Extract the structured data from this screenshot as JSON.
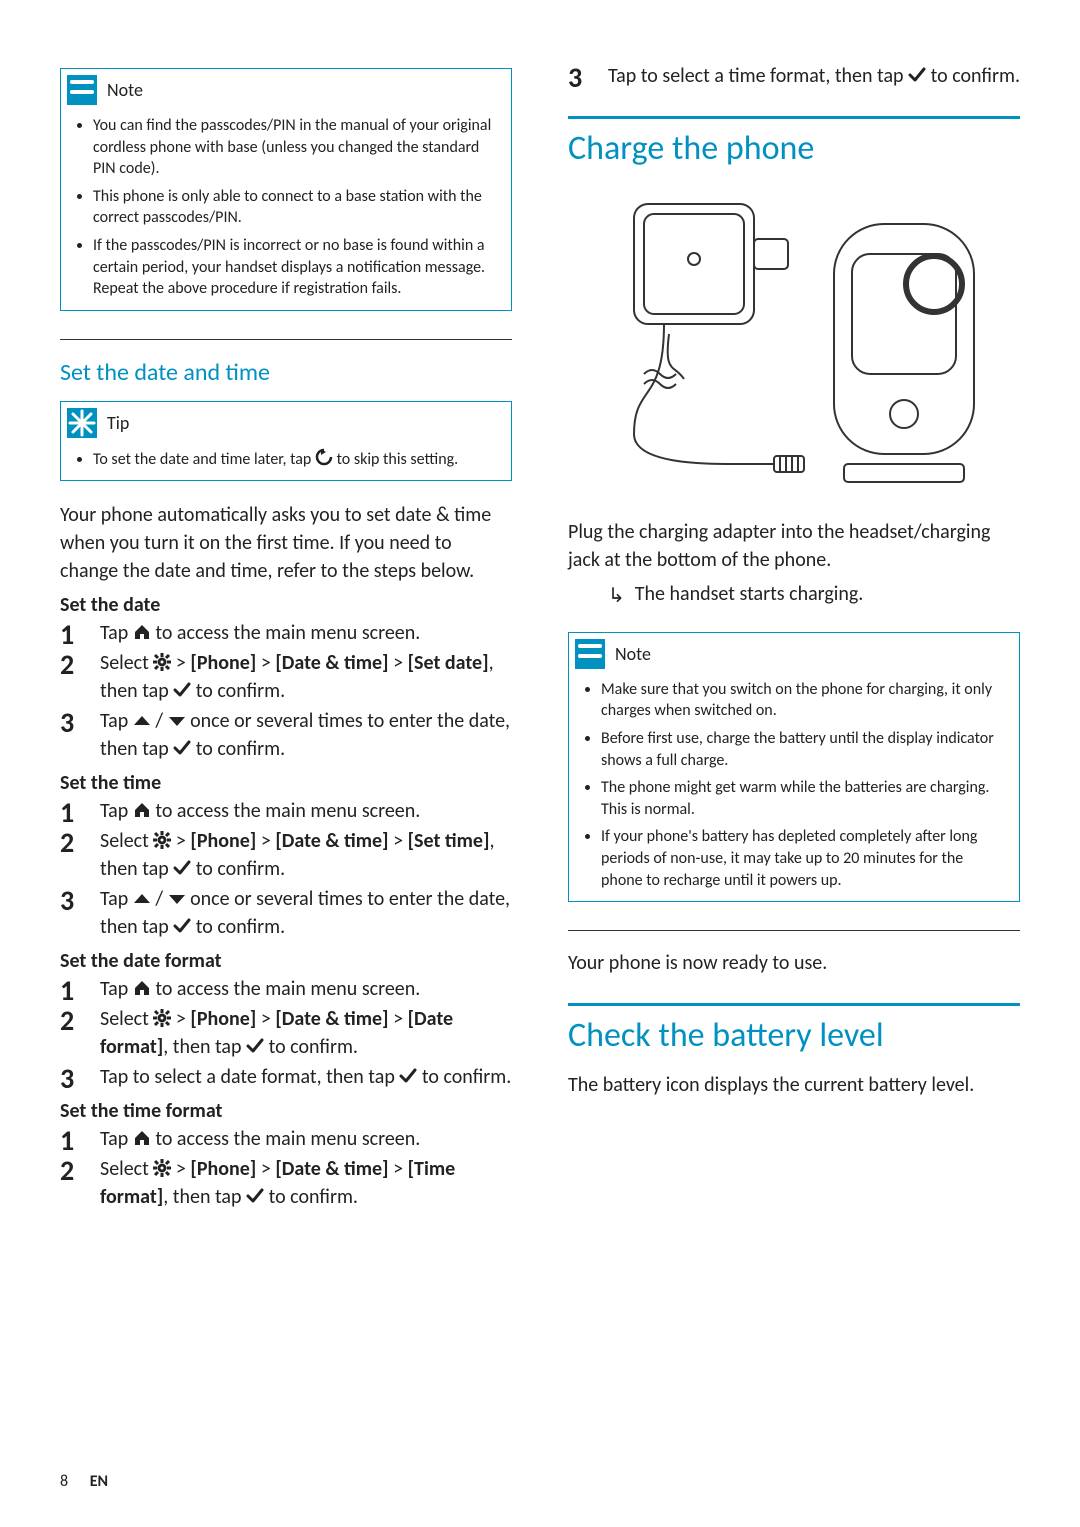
{
  "note1": {
    "title": "Note",
    "items": [
      "You can find the passcodes/PIN in the manual of your original cordless phone with base (unless you changed the standard PIN code).",
      "This phone is only able to connect to a base station with the correct passcodes/PIN.",
      "If the passcodes/PIN is incorrect or no base is found within a certain period, your handset displays a notification message. Repeat the above procedure if registration fails."
    ]
  },
  "sec_datetime": {
    "heading": "Set the date and time"
  },
  "tip1": {
    "title": "Tip",
    "inline": {
      "pre": "To set the date and time later, tap ",
      "post": " to skip this setting."
    }
  },
  "intro_datetime": "Your phone automatically asks you to set date & time when you turn it on the first time. If you need to change the date and time, refer to the steps below.",
  "groups": {
    "set_date": {
      "title": "Set the date",
      "steps": {
        "s1": {
          "pre": "Tap ",
          "post": " to access the main menu screen."
        },
        "s2": {
          "pre": "Select ",
          "mid": " > ",
          "a": "[Phone]",
          "b": "[Date & time]",
          "c": "[Set date]",
          "then": ", then tap ",
          "post": " to confirm."
        },
        "s3": {
          "pre": "Tap ",
          "sep": " / ",
          "mid": " once or several times to enter the date, then tap ",
          "post": " to confirm."
        }
      }
    },
    "set_time": {
      "title": "Set the time",
      "steps": {
        "s1": {
          "pre": "Tap ",
          "post": " to access the main menu screen."
        },
        "s2": {
          "pre": "Select ",
          "mid": " > ",
          "a": "[Phone]",
          "b": "[Date & time]",
          "c": "[Set time]",
          "then": ", then tap ",
          "post": " to confirm."
        },
        "s3": {
          "pre": "Tap ",
          "sep": " / ",
          "mid": " once or several times to enter the date, then tap ",
          "post": " to confirm."
        }
      }
    },
    "date_fmt": {
      "title": "Set the date format",
      "steps": {
        "s1": {
          "pre": "Tap ",
          "post": " to access the main menu screen."
        },
        "s2": {
          "pre": "Select ",
          "mid": " > ",
          "a": "[Phone]",
          "b": "[Date & time]",
          "c": "[Date format]",
          "then": ", then tap ",
          "post": " to confirm."
        },
        "s3": {
          "pre": "Tap to select a date format, then tap ",
          "post": " to confirm."
        }
      }
    },
    "time_fmt": {
      "title": "Set the time format",
      "steps": {
        "s1": {
          "pre": "Tap ",
          "post": " to access the main menu screen."
        },
        "s2": {
          "pre": "Select ",
          "mid": " > ",
          "a": "[Phone]",
          "b": "[Date & time]",
          "c": "[Time format]",
          "then": ", then tap ",
          "post": " to confirm."
        }
      }
    }
  },
  "right_step3": {
    "pre": "Tap to select a time format, then tap ",
    "post": " to confirm."
  },
  "sec_charge": {
    "heading": "Charge the phone",
    "body": "Plug the charging adapter into the headset/charging jack at the bottom of the phone.",
    "result": "The handset starts charging."
  },
  "note2": {
    "title": "Note",
    "items": [
      "Make sure that you switch on the phone for charging, it only charges when switched on.",
      "Before first use, charge the battery until the display indicator shows a full charge.",
      "The phone might get warm while the batteries are charging. This is normal.",
      "If your phone's battery has depleted completely after long periods of non-use, it may take up to 20 minutes for the phone to recharge until it powers up."
    ]
  },
  "ready": "Your phone is now ready to use.",
  "sec_battery": {
    "heading": "Check the battery level",
    "body": "The battery icon displays the current battery level."
  },
  "footer": {
    "page": "8",
    "lang": "EN"
  }
}
